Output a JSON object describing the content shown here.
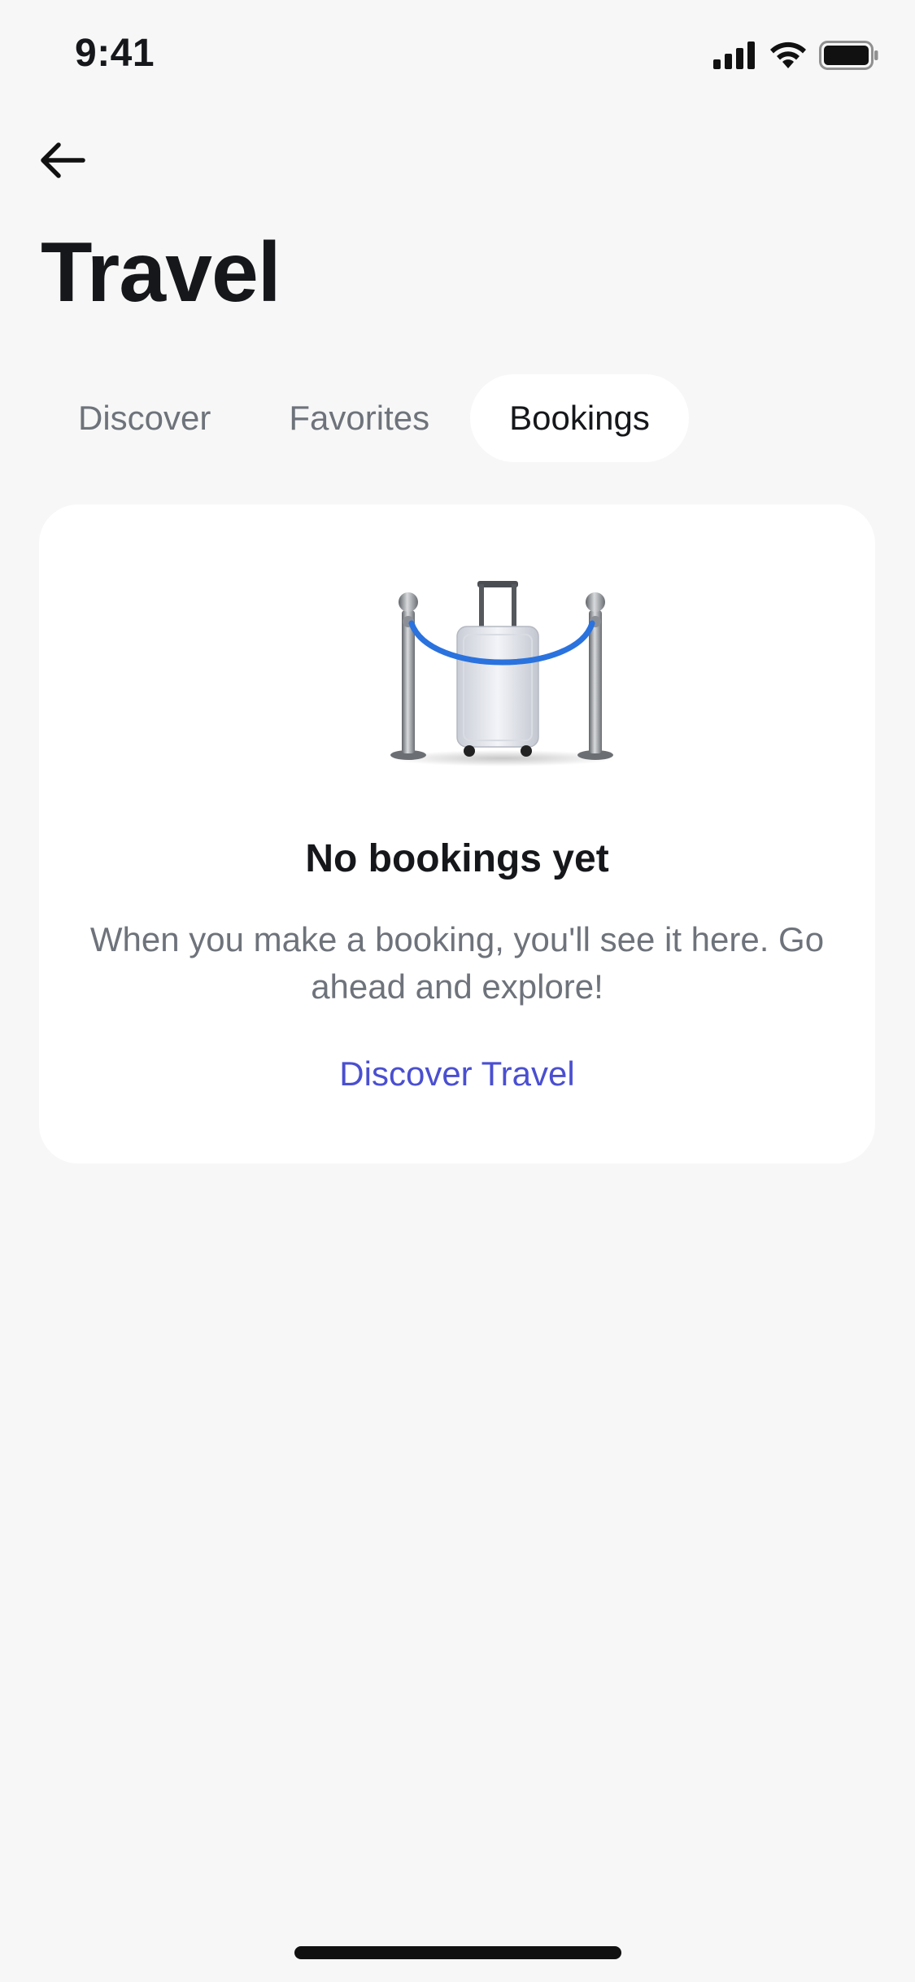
{
  "status_bar": {
    "time": "9:41",
    "icons": [
      "cellular-signal-icon",
      "wifi-icon",
      "battery-icon"
    ]
  },
  "header": {
    "back_icon": "arrow-left-icon",
    "title": "Travel"
  },
  "tabs": [
    {
      "label": "Discover",
      "active": false
    },
    {
      "label": "Favorites",
      "active": false
    },
    {
      "label": "Bookings",
      "active": true
    }
  ],
  "empty_state": {
    "illustration": "luggage-with-stanchions-illustration",
    "title": "No bookings yet",
    "message": "When you make a booking, you'll see it here. Go ahead and explore!",
    "link_label": "Discover Travel"
  },
  "colors": {
    "background": "#f7f7f7",
    "card": "#ffffff",
    "accent": "#4a4fd0",
    "muted_text": "#6e737b",
    "rope": "#2a72de"
  }
}
